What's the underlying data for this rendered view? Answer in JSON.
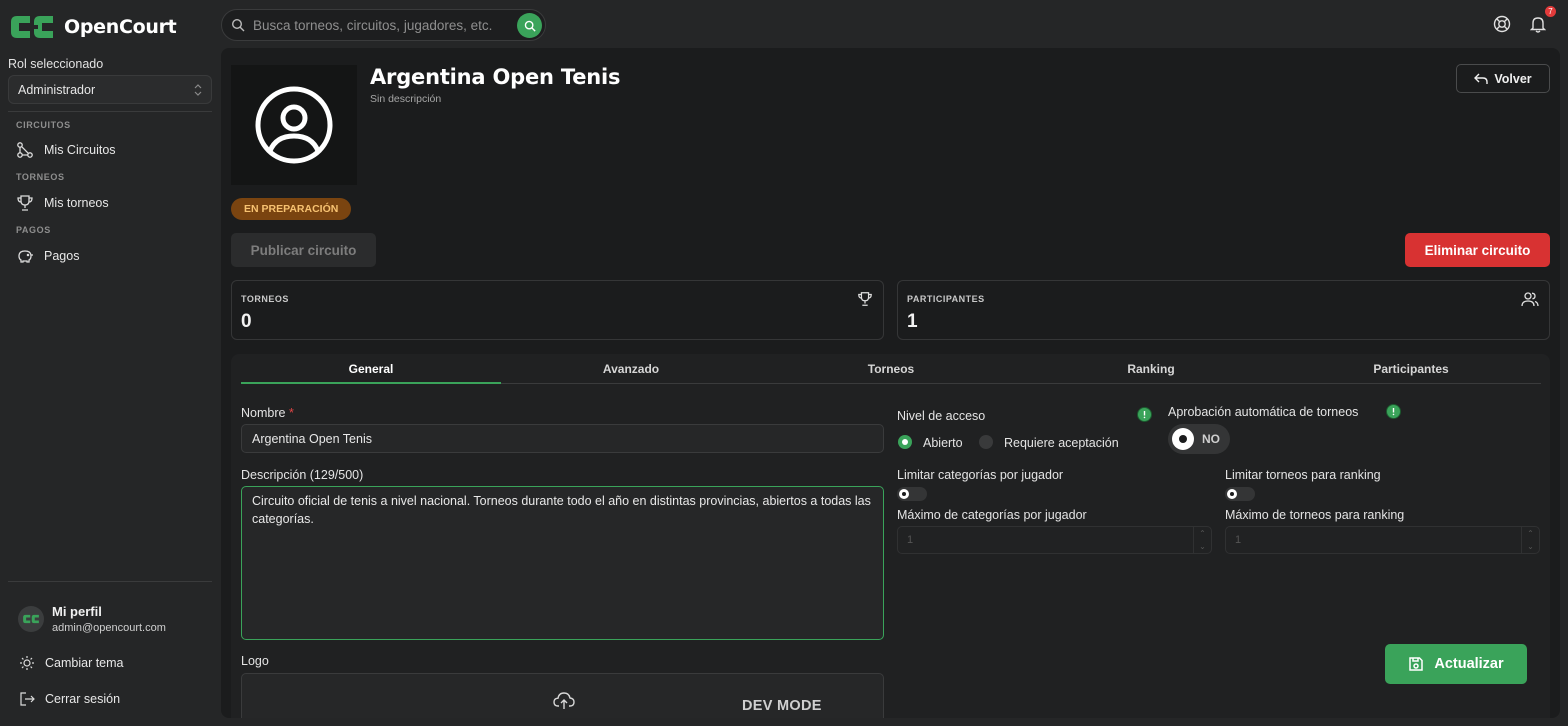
{
  "app": {
    "name": "OpenCourt",
    "brand_color": "#3aa35a"
  },
  "sidebar": {
    "role_label": "Rol seleccionado",
    "role_value": "Administrador",
    "sections": [
      {
        "label": "CIRCUITOS",
        "item": "Mis Circuitos",
        "icon": "circuit-icon"
      },
      {
        "label": "TORNEOS",
        "item": "Mis torneos",
        "icon": "trophy-icon"
      },
      {
        "label": "PAGOS",
        "item": "Pagos",
        "icon": "piggy-bank-icon"
      }
    ],
    "profile": {
      "name": "Mi perfil",
      "email": "admin@opencourt.com"
    },
    "theme_label": "Cambiar tema",
    "logout_label": "Cerrar sesión"
  },
  "topbar": {
    "search_placeholder": "Busca torneos, circuitos, jugadores, etc.",
    "notifications_count": "7"
  },
  "circuit": {
    "title": "Argentina Open Tenis",
    "subtitle": "Sin descripción",
    "back_label": "Volver",
    "status": "EN PREPARACIÓN",
    "publish_label": "Publicar circuito",
    "delete_label": "Eliminar circuito"
  },
  "stats": [
    {
      "label": "TORNEOS",
      "value": "0",
      "icon": "trophy-icon"
    },
    {
      "label": "PARTICIPANTES",
      "value": "1",
      "icon": "users-icon"
    }
  ],
  "tabs": [
    "General",
    "Avanzado",
    "Torneos",
    "Ranking",
    "Participantes"
  ],
  "active_tab": "General",
  "form": {
    "name_label": "Nombre",
    "name_required": "*",
    "name_value": "Argentina Open Tenis",
    "desc_label": "Descripción (129/500)",
    "desc_value": "Circuito oficial de tenis a nivel nacional. Torneos durante todo el año en distintas provincias, abiertos a todas las categorías.",
    "logo_label": "Logo",
    "dev_mode": "DEV MODE",
    "access_label": "Nivel de acceso",
    "access_options": [
      "Abierto",
      "Requiere aceptación"
    ],
    "access_selected": "Abierto",
    "auto_approve_label": "Aprobación automática de torneos",
    "auto_approve_value": "NO",
    "limit_categories_label": "Limitar categorías por jugador",
    "limit_tournaments_label": "Limitar torneos para ranking",
    "max_categories_label": "Máximo de categorías por jugador",
    "max_categories_value": "1",
    "max_tournaments_label": "Máximo de torneos para ranking",
    "max_tournaments_value": "1",
    "update_label": "Actualizar"
  }
}
